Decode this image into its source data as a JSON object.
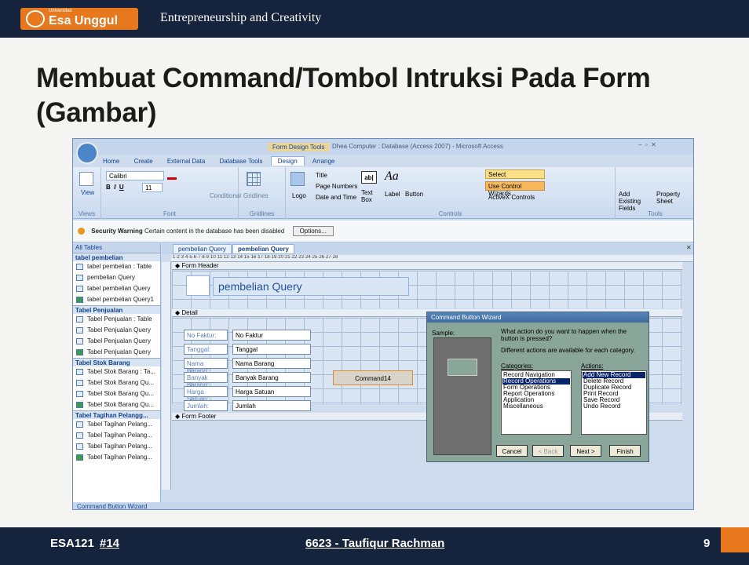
{
  "header": {
    "logo_small": "Universitas",
    "logo_text": "Esa Unggul",
    "course": "Entrepreneurship and Creativity"
  },
  "slide": {
    "title": "Membuat Command/Tombol Intruksi Pada Form (Gambar)"
  },
  "access": {
    "window_title": "Dhea Computer : Database (Access 2007) - Microsoft Access",
    "context_tab": "Form Design Tools",
    "tabs": [
      "Home",
      "Create",
      "External Data",
      "Database Tools",
      "Design",
      "Arrange"
    ],
    "ribbon": {
      "view": "View",
      "views_group": "Views",
      "font_name": "Calibri",
      "font_size": "11",
      "font_group": "Font",
      "conditional": "Conditional",
      "gridlines": "Gridlines",
      "gridlines_group": "Gridlines",
      "logo": "Logo",
      "title": "Title",
      "page_numbers": "Page Numbers",
      "date_time": "Date and Time",
      "text_box": "Text Box",
      "label": "Label",
      "button": "Button",
      "controls_group": "Controls",
      "select": "Select",
      "use_control_wizards": "Use Control Wizards",
      "activex": "ActiveX Controls",
      "add_existing": "Add Existing Fields",
      "property_sheet": "Property Sheet",
      "tools_group": "Tools"
    },
    "security": {
      "label": "Security Warning",
      "message": "Certain content in the database has been disabled",
      "options": "Options..."
    },
    "nav": {
      "header": "All Tables",
      "groups": [
        {
          "name": "tabel pembelian",
          "items": [
            "tabel pembelian : Table",
            "pembelian Query",
            "tabel pembelian Query",
            "tabel pembelian Query1"
          ]
        },
        {
          "name": "Tabel Penjualan",
          "items": [
            "Tabel Penjualan : Table",
            "Tabel Penjualan Query",
            "Tabel Penjualan Query",
            "Tabel Penjualan Query"
          ]
        },
        {
          "name": "Tabel Stok Barang",
          "items": [
            "Tabel Stok Barang : Ta...",
            "Tabel Stok Barang Qu...",
            "Tabel Stok Barang Qu...",
            "Tabel Stok Barang Qu..."
          ]
        },
        {
          "name": "Tabel Tagihan Pelangg...",
          "items": [
            "Tabel Tagihan Pelang...",
            "Tabel Tagihan Pelang...",
            "Tabel Tagihan Pelang...",
            "Tabel Tagihan Pelang..."
          ]
        }
      ]
    },
    "doc_tabs": [
      "pembelian Query",
      "pembelian Query"
    ],
    "form": {
      "header_section": "Form Header",
      "detail_section": "Detail",
      "footer_section": "Form Footer",
      "form_title": "pembelian Query",
      "fields": [
        {
          "label": "No Faktur:",
          "field": "No Faktur"
        },
        {
          "label": "Tanggal:",
          "field": "Tanggal"
        },
        {
          "label": "Nama Barang:",
          "field": "Nama Barang"
        },
        {
          "label": "Banyak Barang:",
          "field": "Banyak Barang"
        },
        {
          "label": "Harga Satuan:",
          "field": "Harga Satuan"
        },
        {
          "label": "Jumlah:",
          "field": "Jumlah"
        }
      ],
      "command": "Command14"
    },
    "wizard": {
      "title": "Command Button Wizard",
      "sample": "Sample:",
      "question": "What action do you want to happen when the button is pressed?",
      "hint": "Different actions are available for each category.",
      "categories_label": "Categories:",
      "actions_label": "Actions:",
      "categories": [
        "Record Navigation",
        "Record Operations",
        "Form Operations",
        "Report Operations",
        "Application",
        "Miscellaneous"
      ],
      "actions": [
        "Add New Record",
        "Delete Record",
        "Duplicate Record",
        "Print Record",
        "Save Record",
        "Undo Record"
      ],
      "buttons": {
        "cancel": "Cancel",
        "back": "< Back",
        "next": "Next >",
        "finish": "Finish"
      }
    },
    "status": "Command Button Wizard"
  },
  "footer": {
    "code": "ESA121",
    "num": "#14",
    "author": "6623 - Taufiqur Rachman",
    "page": "9"
  }
}
